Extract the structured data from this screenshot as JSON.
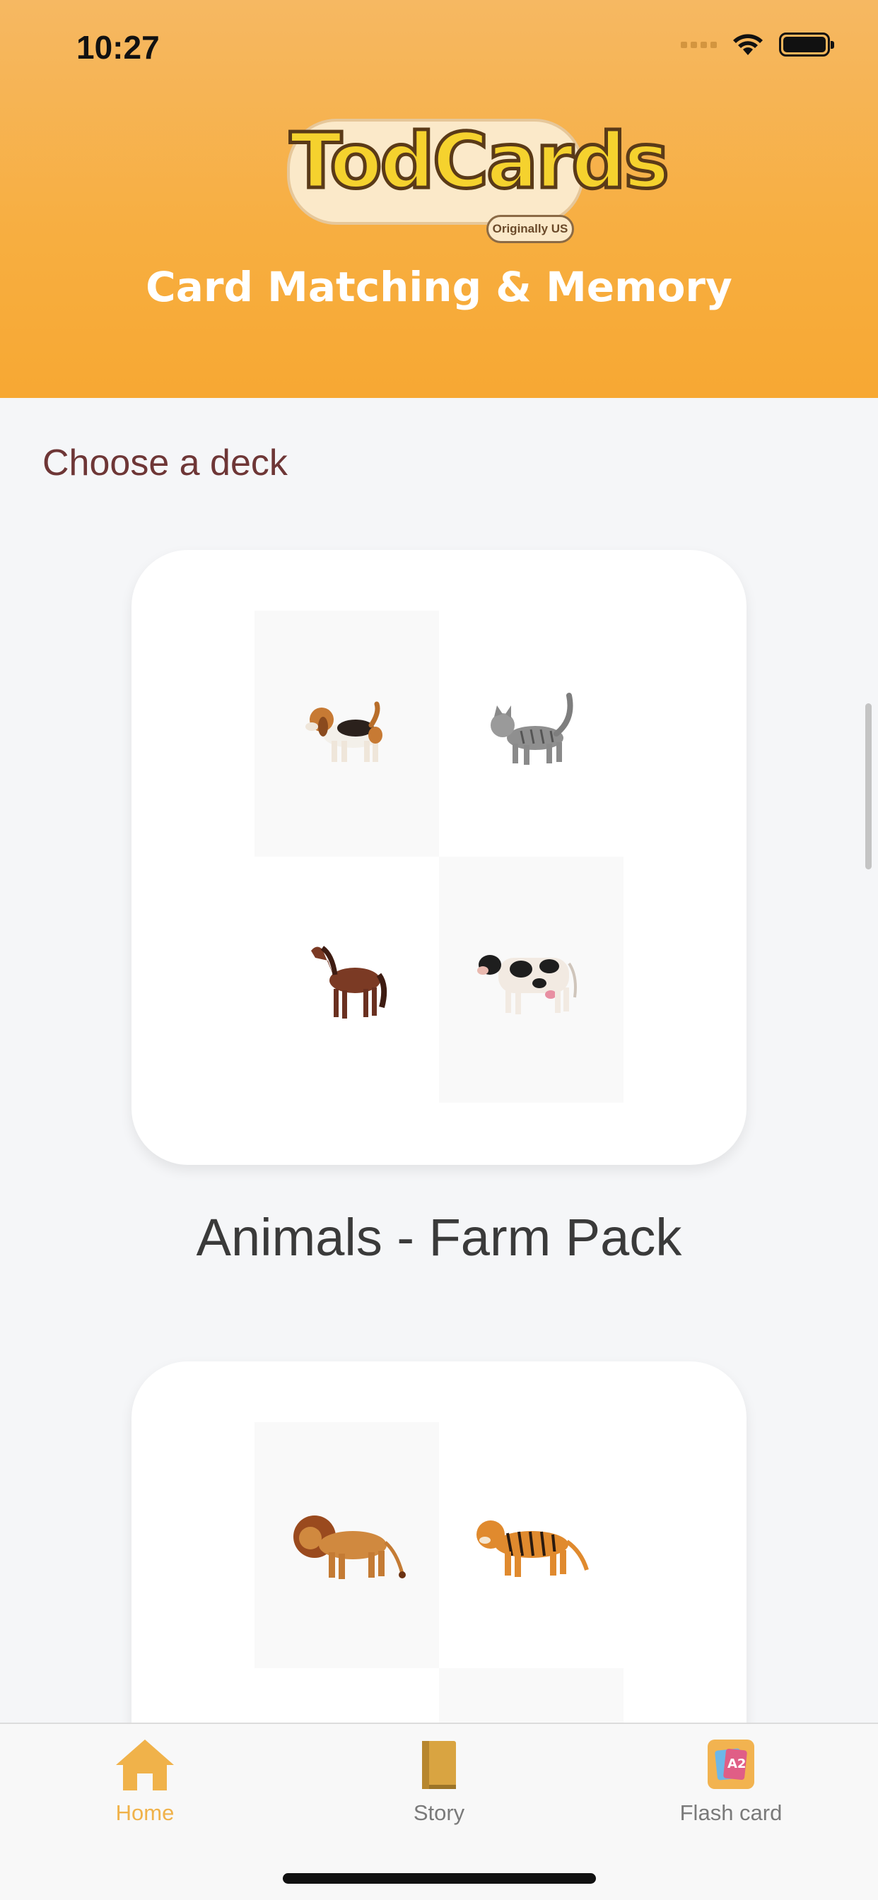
{
  "status_bar": {
    "time": "10:27"
  },
  "header": {
    "logo_text": "TodCards",
    "logo_tag": "Originally US",
    "title": "Card Matching & Memory"
  },
  "section": {
    "title": "Choose a deck"
  },
  "decks": [
    {
      "title": "Animals - Farm Pack",
      "animals": [
        "beagle-dog",
        "gray-cat",
        "brown-horse",
        "holstein-cow"
      ]
    },
    {
      "title": "",
      "animals": [
        "lion",
        "tiger"
      ]
    }
  ],
  "tabbar": {
    "items": [
      {
        "label": "Home",
        "icon": "home-icon",
        "active": true
      },
      {
        "label": "Story",
        "icon": "book-icon",
        "active": false
      },
      {
        "label": "Flash card",
        "icon": "flash-card-icon",
        "active": false
      }
    ]
  },
  "colors": {
    "header_orange": "#F7AE40",
    "tab_active": "#F0B24A",
    "tab_inactive": "#7A7A7A",
    "section_title": "#6E3636"
  }
}
